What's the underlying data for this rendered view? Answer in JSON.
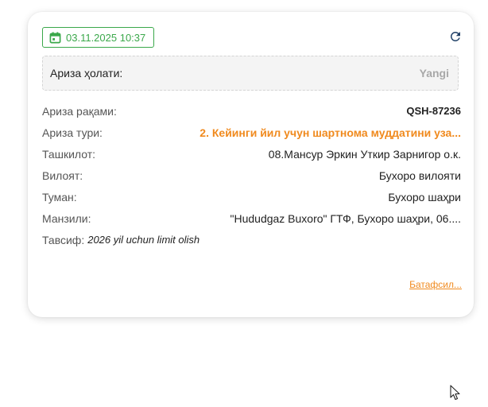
{
  "card": {
    "date": "03.11.2025 10:37",
    "status": {
      "label": "Ариза ҳолати:",
      "value": "Yangi"
    },
    "fields": [
      {
        "label": "Ариза рақами:",
        "value": "QSH-87236"
      },
      {
        "label": "Ариза тури:",
        "value": "2. Кейинги йил учун шартнома муддатини уза..."
      },
      {
        "label": "Ташкилот:",
        "value": "08.Мансур Эркин Уткир Зарнигор о.к."
      },
      {
        "label": "Вилоят:",
        "value": "Бухоро вилояти"
      },
      {
        "label": "Туман:",
        "value": "Бухоро шаҳри"
      },
      {
        "label": "Манзили:",
        "value": "\"Hududgaz Buxoro\" ГТФ, Бухоро шаҳри, 06...."
      }
    ],
    "description": {
      "label": "Тавсиф:",
      "value": "2026 yil uchun limit olish"
    },
    "more_link": "Батафсил..."
  },
  "icons": {
    "calendar": "calendar-icon",
    "refresh": "refresh-icon",
    "cursor": "mouse-pointer-icon"
  },
  "colors": {
    "green": "#3aa84a",
    "orange": "#f08a1e",
    "navy": "#1f3f66",
    "muted": "#a8a8a8"
  }
}
